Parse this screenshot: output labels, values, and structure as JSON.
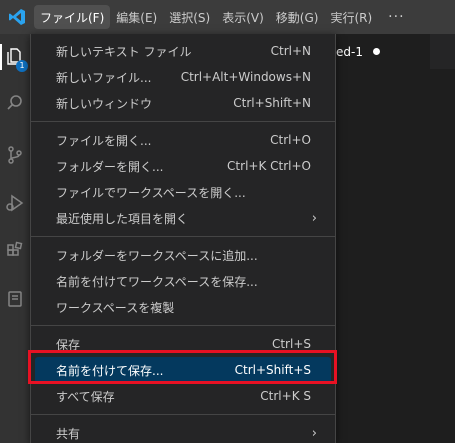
{
  "menubar": {
    "items": [
      "ファイル(F)",
      "編集(E)",
      "選択(S)",
      "表示(V)",
      "移動(G)",
      "実行(R)"
    ],
    "more": "···"
  },
  "activity": {
    "explorer_badge": "1"
  },
  "editor": {
    "tab_label": "ed-1"
  },
  "file_menu": {
    "groups": [
      [
        {
          "label": "新しいテキスト ファイル",
          "shortcut": "Ctrl+N"
        },
        {
          "label": "新しいファイル...",
          "shortcut": "Ctrl+Alt+Windows+N"
        },
        {
          "label": "新しいウィンドウ",
          "shortcut": "Ctrl+Shift+N"
        }
      ],
      [
        {
          "label": "ファイルを開く...",
          "shortcut": "Ctrl+O"
        },
        {
          "label": "フォルダーを開く...",
          "shortcut": "Ctrl+K Ctrl+O"
        },
        {
          "label": "ファイルでワークスペースを開く...",
          "shortcut": ""
        },
        {
          "label": "最近使用した項目を開く",
          "shortcut": "",
          "submenu": true
        }
      ],
      [
        {
          "label": "フォルダーをワークスペースに追加...",
          "shortcut": ""
        },
        {
          "label": "名前を付けてワークスペースを保存...",
          "shortcut": ""
        },
        {
          "label": "ワークスペースを複製",
          "shortcut": ""
        }
      ],
      [
        {
          "label": "保存",
          "shortcut": "Ctrl+S"
        },
        {
          "label": "名前を付けて保存...",
          "shortcut": "Ctrl+Shift+S",
          "highlighted": true
        },
        {
          "label": "すべて保存",
          "shortcut": "Ctrl+K S"
        }
      ],
      [
        {
          "label": "共有",
          "shortcut": "",
          "submenu": true
        }
      ]
    ]
  },
  "colors": {
    "highlight": "#04395e",
    "annotation_box": "#e81123",
    "accent": "#0e70c0"
  }
}
